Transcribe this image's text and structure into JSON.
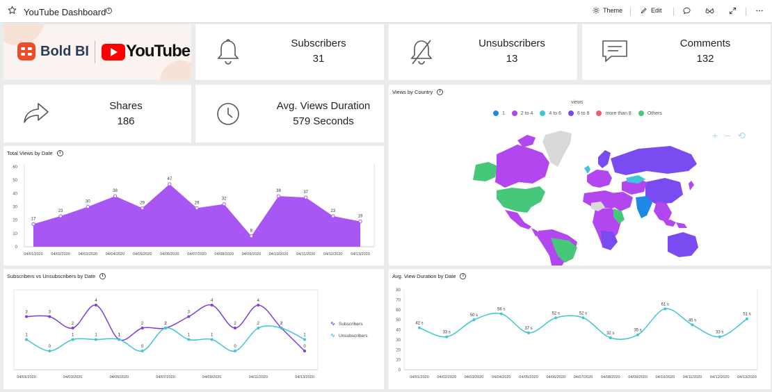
{
  "header": {
    "title": "YouTube Dashboard",
    "theme_label": "Theme",
    "edit_label": "Edit"
  },
  "logo": {
    "bold_bi_text": "Bold BI",
    "youtube_text": "YouTube"
  },
  "kpis": {
    "subscribers": {
      "label": "Subscribers",
      "value": "31"
    },
    "unsubscribers": {
      "label": "Unsubscribers",
      "value": "13"
    },
    "comments": {
      "label": "Comments",
      "value": "132"
    },
    "shares": {
      "label": "Shares",
      "value": "186"
    },
    "avg_duration": {
      "label": "Avg. Views Duration",
      "value": "579 Seconds"
    }
  },
  "map": {
    "title": "Views by Country",
    "legend_title": "views",
    "legend": [
      {
        "label": "1",
        "color": "#1e88e5"
      },
      {
        "label": "2 to 4",
        "color": "#b247f0"
      },
      {
        "label": "4 to 6",
        "color": "#3fc6d6"
      },
      {
        "label": "6 to 8",
        "color": "#7a4bf0"
      },
      {
        "label": "more than 8",
        "color": "#f05a6a"
      },
      {
        "label": "Others",
        "color": "#46c77a"
      }
    ]
  },
  "chart_data": [
    {
      "type": "area",
      "title": "Total Views by Date",
      "categories": [
        "04/01/2020",
        "04/02/2020",
        "04/03/2020",
        "04/04/2020",
        "04/05/2020",
        "04/06/2020",
        "04/07/2020",
        "04/08/2020",
        "04/09/2020",
        "04/10/2020",
        "04/11/2020",
        "04/12/2020",
        "04/13/2020"
      ],
      "values": [
        17,
        23,
        30,
        38,
        29,
        47,
        29,
        32,
        8,
        38,
        37,
        23,
        19
      ],
      "ylim": [
        0,
        60
      ],
      "yticks": [
        0,
        10,
        20,
        30,
        40,
        50,
        60
      ],
      "color": "#a857f5",
      "grid": false
    },
    {
      "type": "line",
      "title": "Subscribers vs Unsubscribers  by Date",
      "categories": [
        "04/01/2020",
        "04/02/2020",
        "04/03/2020",
        "04/04/2020",
        "04/05/2020",
        "04/06/2020",
        "04/07/2020",
        "04/08/2020",
        "04/09/2020",
        "04/10/2020",
        "04/11/2020",
        "04/12/2020",
        "04/13/2020"
      ],
      "xtick_labels": [
        "04/01/2020",
        "04/03/2020",
        "04/05/2020",
        "04/07/2020",
        "04/09/2020",
        "04/11/2020",
        "04/13/2020"
      ],
      "series": [
        {
          "name": "Subscribers",
          "color": "#7c3cde",
          "values": [
            3,
            3,
            2,
            4,
            1,
            2,
            2,
            3,
            4,
            2,
            4,
            2,
            0
          ]
        },
        {
          "name": "Unsubscribers",
          "color": "#3fc6d6",
          "values": [
            1,
            0,
            1,
            1,
            1,
            0,
            2,
            1,
            1,
            0,
            2,
            2,
            1
          ]
        }
      ],
      "ylim": [
        0,
        4.5
      ],
      "legend_position": "right"
    },
    {
      "type": "line",
      "title": "Avg. View Duration by Date",
      "categories": [
        "04/01/2020",
        "04/02/2020",
        "04/03/2020",
        "04/04/2020",
        "04/05/2020",
        "04/06/2020",
        "04/07/2020",
        "04/08/2020",
        "04/09/2020",
        "04/10/2020",
        "04/11/2020",
        "04/12/2020",
        "04/13/2020"
      ],
      "values": [
        42,
        33,
        50,
        56,
        37,
        52,
        52,
        32,
        35,
        61,
        45,
        33,
        51
      ],
      "data_labels": [
        "42 s",
        "33 s",
        "50 s",
        "56 s",
        "37 s",
        "52 s",
        "52 s",
        "32 s",
        "35 s",
        "61 s",
        "45 s",
        "33 s",
        "51 s"
      ],
      "ylim": [
        0,
        80
      ],
      "yticks": [
        0,
        10,
        20,
        30,
        40,
        50,
        60,
        70,
        80
      ],
      "color": "#3fc6d6"
    }
  ]
}
